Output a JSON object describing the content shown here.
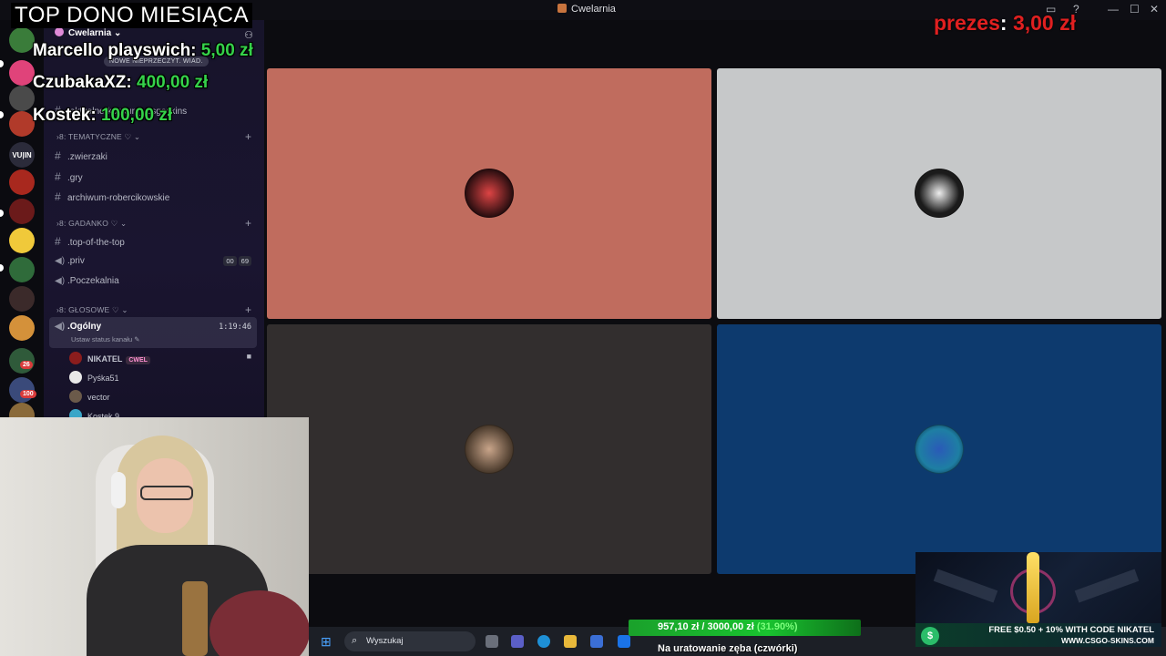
{
  "window": {
    "title": "Cwelarnia"
  },
  "server": {
    "name": "Cwelarnia",
    "new_messages_pill": "NOWE NIEPRZECZYT. WIAD.",
    "channels_top": [
      {
        "icon": "#",
        "name": ".aktualne-konkursy-csgoskins"
      }
    ],
    "categories": [
      {
        "name": "TEMATYCZNE",
        "channels": [
          {
            "icon": "#",
            "name": ".zwierzaki"
          },
          {
            "icon": "#",
            "name": ".gry"
          },
          {
            "icon": "#",
            "name": "archiwum-robercikowskie"
          }
        ]
      },
      {
        "name": "GADANKO",
        "channels": [
          {
            "icon": "#",
            "name": ".top-of-the-top"
          },
          {
            "icon": "speaker",
            "name": ".priv",
            "counts": [
              "00",
              "69"
            ]
          },
          {
            "icon": "speaker",
            "name": ".Poczekalnia"
          }
        ]
      },
      {
        "name": "GŁOSOWE",
        "channels": [
          {
            "icon": "speaker",
            "name": ".Ogólny",
            "timer": "1:19:46",
            "status": "Ustaw status kanału"
          }
        ]
      }
    ],
    "voice_users": [
      {
        "name": "NIKATEL",
        "tag": "CWEL",
        "color": "#8b1d1d"
      },
      {
        "name": "Pyśka51",
        "color": "#e8e8e8"
      },
      {
        "name": "vector",
        "color": "#6b5a4a"
      },
      {
        "name": "Kostek.9",
        "color": "#3aa6c8"
      }
    ]
  },
  "overlay": {
    "title": "TOP DONO MIESIĄCA",
    "donors": [
      {
        "name": "Marcello playswich:",
        "amount": "5,00 zł"
      },
      {
        "name": "CzubakaXZ:",
        "amount": "400,00 zł"
      },
      {
        "name": "Kostek:",
        "amount": "100,00 zł"
      }
    ],
    "top": {
      "name": "prezes",
      "colon": ":",
      "amount": "3,00 zł"
    }
  },
  "tiles": [
    {
      "bg": "#c06c5e",
      "avatar": "#2a0e10"
    },
    {
      "bg": "#c6c8c9",
      "avatar": "#1b1b1b"
    },
    {
      "bg": "#322e2e",
      "avatar": "#7a6a5c"
    },
    {
      "bg": "#0d3a6e",
      "avatar": "#1e7fa3"
    }
  ],
  "goal": {
    "current": "957,10 zł",
    "separator": "/",
    "target": "3000,00 zł",
    "percent": "(31.90%)",
    "percent_value": 31.9,
    "subtitle": "Na uratowanie zęba (czwórki)"
  },
  "taskbar": {
    "search_placeholder": "Wyszukaj"
  },
  "sponsor": {
    "line1": "FREE $0.50 + 10% WITH CODE NIKATEL",
    "line2": "WWW.CSGO-SKINS.COM"
  }
}
